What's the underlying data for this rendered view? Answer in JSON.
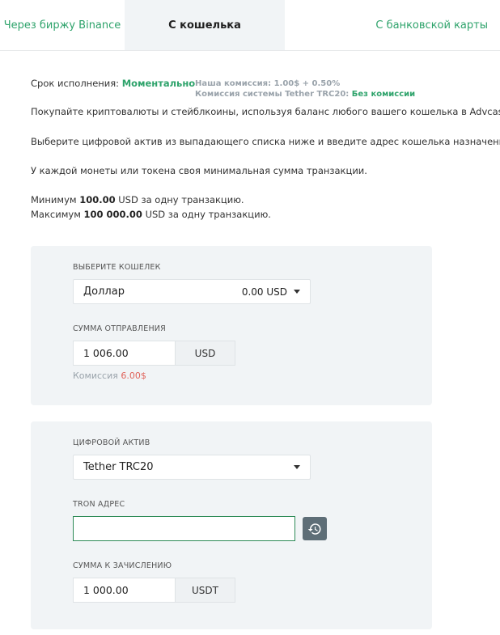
{
  "tabs": [
    {
      "label": "Через биржу Binance"
    },
    {
      "label": "С кошелька"
    },
    {
      "label": "С банковской карты"
    }
  ],
  "info": {
    "exec_label": "Срок исполнения:",
    "exec_value": "Моментально",
    "our_fee": "Наша комиссия: 1.00$ + 0.50%",
    "system_fee_label": "Комиссия системы Tether TRC20:",
    "system_fee_value": "Без комиссии",
    "desc1": "Покупайте криптовалюты и стейблкоины, используя баланс любого вашего кошелька в Advcash.",
    "desc2": "Выберите цифровой актив из выпадающего списка ниже и введите адрес кошелька назначения.",
    "desc3": "У каждой монеты или токена своя минимальная сумма транзакции.",
    "min_prefix": "Минимум",
    "min_value": "100.00",
    "min_suffix": "USD за одну транзакцию.",
    "max_prefix": "Максимум",
    "max_value": "100 000.00",
    "max_suffix": "USD за одну транзакцию."
  },
  "wallet_panel": {
    "wallet_label": "Выберите кошелек",
    "wallet_name": "Доллар",
    "wallet_balance": "0.00 USD",
    "amount_label": "Сумма отправления",
    "amount_value": "1 006.00",
    "amount_currency": "USD",
    "commission_label": "Комиссия",
    "commission_value": "6.00$"
  },
  "asset_panel": {
    "asset_label": "Цифровой актив",
    "asset_value": "Tether TRC20",
    "address_label": "TRON адрес",
    "address_value": "",
    "receive_label": "Сумма к зачислению",
    "receive_value": "1 000.00",
    "receive_currency": "USDT"
  },
  "icons": {
    "history": "history-icon",
    "dropdown": "chevron-down-icon"
  },
  "colors": {
    "accent_green": "#2ea36b",
    "panel_bg": "#f1f4f6",
    "commission_red": "#e0645c",
    "history_button": "#5e6e77"
  }
}
